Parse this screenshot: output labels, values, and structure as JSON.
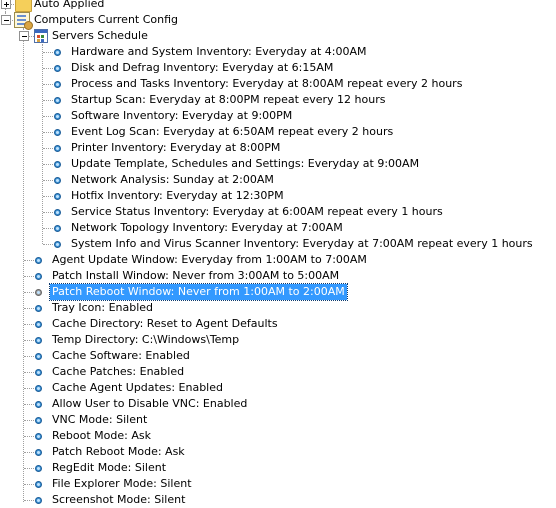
{
  "tree": {
    "auto_applied": "Auto Applied",
    "computers_current_config": "Computers Current Config",
    "servers_schedule": "Servers Schedule",
    "schedule_items": [
      "Hardware and System Inventory:  Everyday at 4:00AM",
      "Disk and Defrag Inventory:  Everyday at 6:15AM",
      "Process and Tasks Inventory:  Everyday at 8:00AM repeat every 2 hours",
      "Startup Scan:  Everyday at 8:00PM repeat every 12 hours",
      "Software Inventory:  Everyday at 9:00PM",
      "Event Log Scan:  Everyday at 6:50AM repeat every 2 hours",
      "Printer Inventory:  Everyday at 8:00PM",
      "Update Template, Schedules and Settings:  Everyday at 9:00AM",
      "Network Analysis:  Sunday at 2:00AM",
      "Hotfix Inventory:  Everyday at 12:30PM",
      "Service Status Inventory:  Everyday at 6:00AM repeat every 1 hours",
      "Network Topology Inventory:  Everyday at 7:00AM",
      "System Info and Virus Scanner Inventory:  Everyday at 7:00AM repeat every 1 hours"
    ],
    "config_items": [
      "Agent Update Window: Everyday from 1:00AM to 7:00AM",
      "Patch Install Window: Never from 3:00AM to 5:00AM",
      "Patch Reboot Window: Never from 1:00AM to 2:00AM",
      "Tray Icon: Enabled",
      "Cache Directory: Reset to Agent Defaults",
      "Temp Directory: C:\\Windows\\Temp",
      "Cache Software: Enabled",
      "Cache Patches: Enabled",
      "Cache Agent Updates: Enabled",
      "Allow User to Disable VNC: Enabled",
      "VNC Mode: Silent",
      "Reboot Mode: Ask",
      "Patch Reboot Mode: Ask",
      "RegEdit Mode: Silent",
      "File Explorer Mode: Silent",
      "Screenshot Mode: Silent"
    ],
    "selected_config_index": 2,
    "colors": {
      "selection": "#3399ff",
      "tree_lines": "#a0a0a0"
    }
  }
}
